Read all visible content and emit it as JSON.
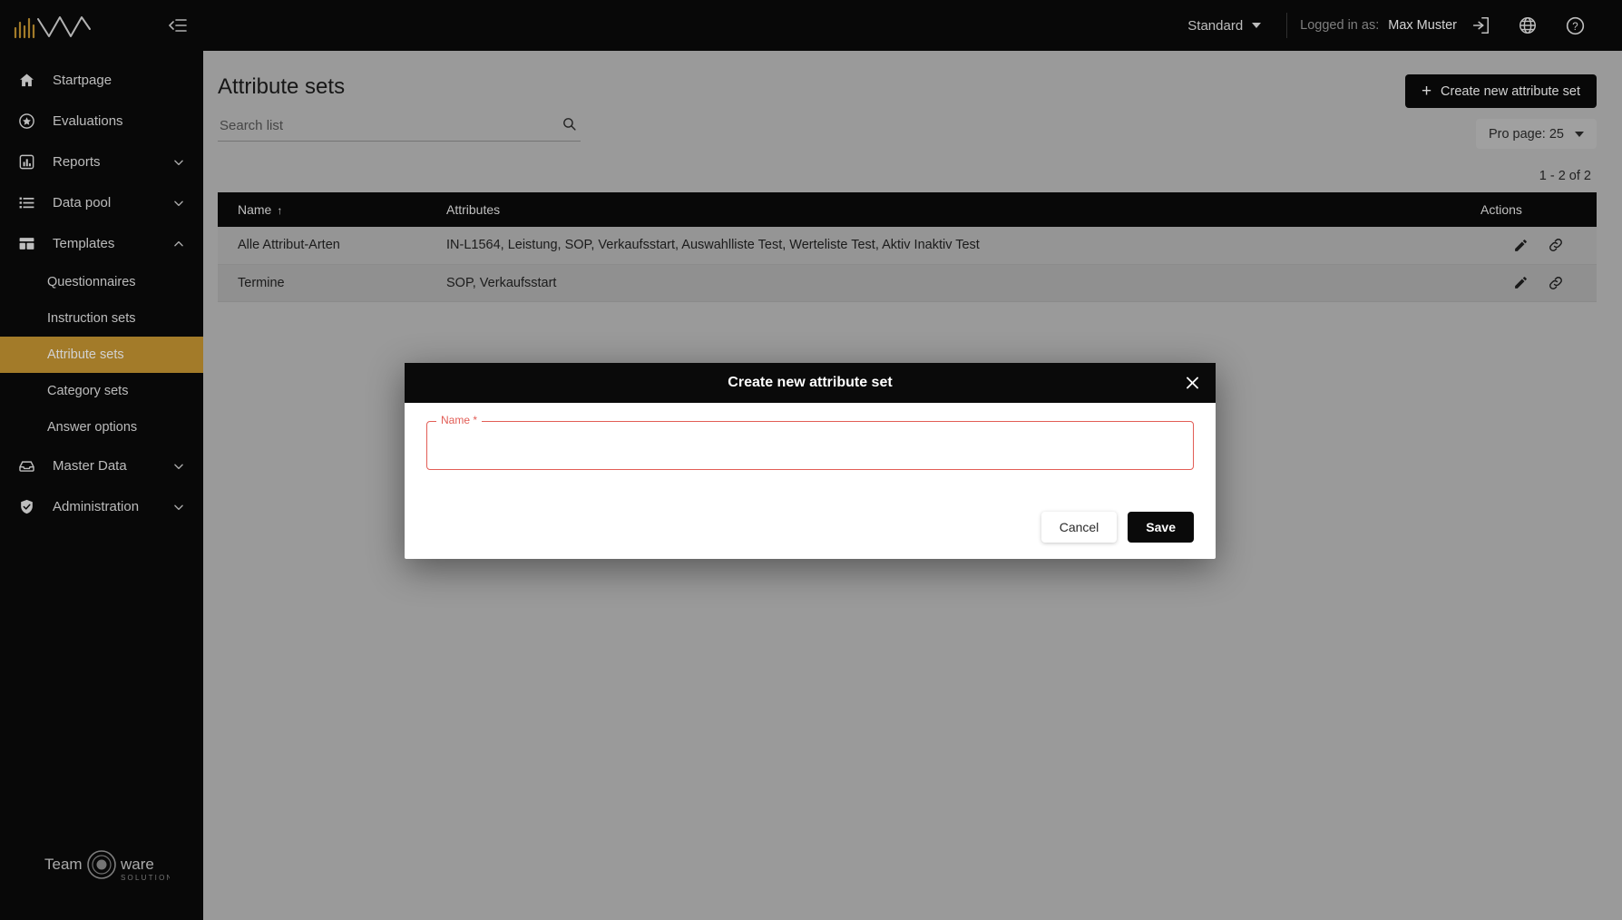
{
  "topbar": {
    "mode_label": "Standard",
    "logged_in_label": "Logged in as:",
    "username": "Max Muster",
    "icons": [
      "login-icon",
      "globe-icon",
      "help-icon"
    ]
  },
  "sidebar": {
    "items": [
      {
        "label": "Startpage",
        "icon": "home-icon",
        "expandable": false
      },
      {
        "label": "Evaluations",
        "icon": "star-icon",
        "expandable": false
      },
      {
        "label": "Reports",
        "icon": "chart-icon",
        "expandable": true,
        "expanded": false
      },
      {
        "label": "Data pool",
        "icon": "list-icon",
        "expandable": true,
        "expanded": false
      },
      {
        "label": "Templates",
        "icon": "templates-icon",
        "expandable": true,
        "expanded": true
      },
      {
        "label": "Master Data",
        "icon": "inbox-icon",
        "expandable": true,
        "expanded": false
      },
      {
        "label": "Administration",
        "icon": "shield-icon",
        "expandable": true,
        "expanded": false
      }
    ],
    "templates_children": [
      {
        "label": "Questionnaires",
        "active": false
      },
      {
        "label": "Instruction sets",
        "active": false
      },
      {
        "label": "Attribute sets",
        "active": true
      },
      {
        "label": "Category sets",
        "active": false
      },
      {
        "label": "Answer options",
        "active": false
      }
    ],
    "footer_logo": {
      "text_left": "Team",
      "text_right": "ware",
      "subtext": "SOLUTIONS"
    },
    "active_color": "#c79733"
  },
  "page": {
    "title": "Attribute sets",
    "create_button": "Create new attribute set",
    "per_page_label": "Pro page: 25",
    "pagination_info": "1 - 2 of 2"
  },
  "search": {
    "placeholder": "Search list",
    "value": ""
  },
  "table": {
    "columns": [
      "Name",
      "Attributes",
      "Actions"
    ],
    "sort_column": "Name",
    "sort_direction": "asc",
    "sort_arrow": "↑",
    "rows": [
      {
        "name": "Alle Attribut-Arten",
        "attributes": "IN-L1564, Leistung, SOP, Verkaufsstart, Auswahlliste Test, Werteliste Test, Aktiv Inaktiv Test",
        "actions": [
          "edit-icon",
          "link-icon"
        ]
      },
      {
        "name": "Termine",
        "attributes": "SOP, Verkaufsstart",
        "actions": [
          "edit-icon",
          "link-icon"
        ]
      }
    ]
  },
  "modal": {
    "title": "Create new attribute set",
    "close_icon": "close-icon",
    "name_field": {
      "label": "Name *",
      "value": "",
      "required": true,
      "error_color": "#e25d56"
    },
    "cancel_label": "Cancel",
    "save_label": "Save"
  }
}
